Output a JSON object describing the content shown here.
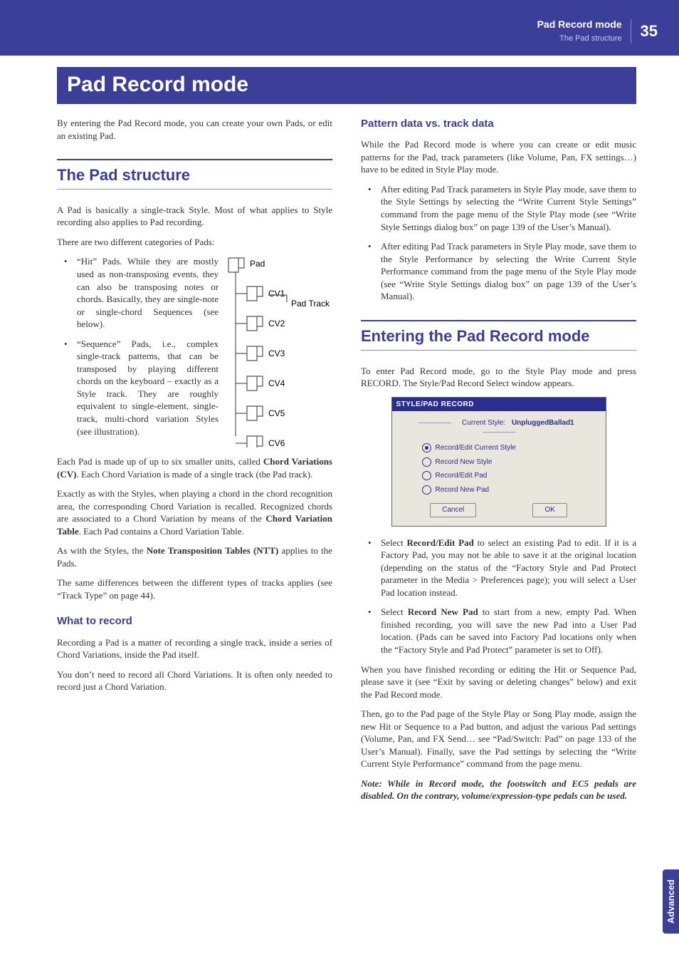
{
  "header": {
    "title": "Pad Record mode",
    "subtitle": "The Pad structure",
    "page": "35"
  },
  "chapter": "Pad Record mode",
  "side_tab": "Advanced",
  "left": {
    "intro": "By entering the Pad Record mode, you can create your own Pads, or edit an existing Pad.",
    "section1_title": "The Pad structure",
    "p1": "A Pad is basically a single-track Style. Most of what applies to Style recording also applies to Pad recording.",
    "p2": "There are two different categories of Pads:",
    "bullets1": [
      "“Hit” Pads. While they are mostly used as non-transposing events, they can also be transposing notes or chords. Basically, they are single-note or single-chord Sequences (see below).",
      "“Sequence” Pads, i.e., complex single-track patterns, that can be transposed by playing different chords on the keyboard – exactly as a Style track. They are roughly equivalent to single-element, single-track, multi-chord variation Styles (see illustration)."
    ],
    "p3a": "Each Pad is made up of up to six smaller units, called ",
    "p3b": "Chord Variations (CV)",
    "p3c": ". Each Chord Variation is made of a single track (the Pad track).",
    "p4a": "Exactly as with the Styles, when playing a chord in the chord recognition area, the corresponding Chord Variation is recalled. Recognized chords are associated to a Chord Variation by means of the ",
    "p4b": "Chord Variation Table",
    "p4c": ". Each Pad contains a Chord Variation Table.",
    "p5a": "As with the Styles, the ",
    "p5b": "Note Transposition Tables (NTT)",
    "p5c": " applies to the Pads.",
    "p6": "The same differences between the different types of tracks applies (see “Track Type” on page 44).",
    "sub1": "What to record",
    "p7": "Recording a Pad is a matter of recording a single track, inside a series of Chord Variations, inside the Pad itself.",
    "p8": "You don’t need to record all Chord Variations. It is often only needed to record just a Chord Variation.",
    "tree": {
      "root": "Pad",
      "track": "Pad Track",
      "items": [
        "CV1",
        "CV2",
        "CV3",
        "CV4",
        "CV5",
        "CV6"
      ]
    }
  },
  "right": {
    "sub1": "Pattern data vs. track data",
    "p1": "While the Pad Record mode is where you can create or edit music patterns for the Pad, track parameters (like Volume, Pan, FX settings…) have to be edited in Style Play mode.",
    "bullets1": [
      "After editing Pad Track parameters in Style Play mode, save them to the Style Settings by selecting the “Write Current Style Settings” command from the page menu of the Style Play mode (see “Write Style Settings dialog box” on page 139 of the User’s Manual).",
      "After editing Pad Track parameters in Style Play mode, save them to the Style Performance by selecting the Write Current Style Performance command from the page menu of the Style Play mode (see “Write Style Settings dialog box” on page 139 of the User’s Manual)."
    ],
    "section2_title": "Entering the Pad Record mode",
    "p2": "To enter Pad Record mode, go to the Style Play mode and press RECORD. The Style/Pad Record Select window appears.",
    "screenshot": {
      "title": "STYLE/PAD RECORD",
      "group_prefix": "Current Style: ",
      "group_value": "UnpluggedBallad1",
      "options": [
        "Record/Edit Current Style",
        "Record New Style",
        "Record/Edit Pad",
        "Record New Pad"
      ],
      "selected_index": 0,
      "cancel": "Cancel",
      "ok": "OK"
    },
    "bullets2_a1": "Select ",
    "bullets2_a2": "Record/Edit Pad",
    "bullets2_a3": " to select an existing Pad to edit. If it is a Factory Pad, you may not be able to save it at the original location (depending on the status of the “Factory Style and Pad Protect parameter in the Media > Preferences page); you will select a User Pad location instead.",
    "bullets2_b1": "Select ",
    "bullets2_b2": "Record New Pad",
    "bullets2_b3": " to start from a new, empty Pad. When finished recording, you will save the new Pad into a User Pad location. (Pads can be saved into Factory Pad locations only when the “Factory Style and Pad Protect” parameter is set to Off).",
    "p3": "When you have finished recording or editing the Hit or Sequence Pad, please save it (see “Exit by saving or deleting changes” below) and exit the Pad Record mode.",
    "p4": "Then, go to the Pad page of the Style Play or Song Play mode, assign the new Hit or Sequence to a Pad button, and adjust the various Pad settings (Volume, Pan, and FX Send… see “Pad/Switch: Pad” on page 133 of the User’s Manual). Finally, save the Pad settings by selecting the “Write Current Style Performance” command from the page menu.",
    "note": "Note: While in Record mode, the footswitch and EC5 pedals are disabled. On the contrary, volume/expression-type pedals can be used."
  }
}
